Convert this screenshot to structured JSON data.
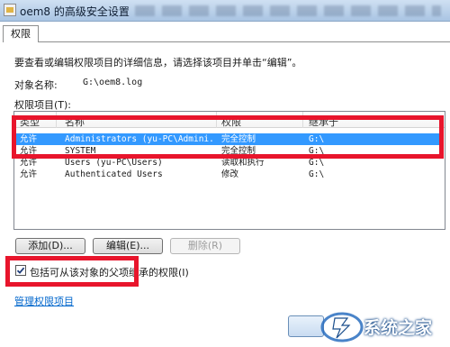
{
  "window": {
    "title": "oem8 的高级安全设置"
  },
  "tabs": [
    {
      "label": "权限"
    }
  ],
  "intro": "要查看或编辑权限项目的详细信息，请选择该项目并单击“编辑”。",
  "object": {
    "label": "对象名称:",
    "value": "G:\\oem8.log"
  },
  "entries_label": "权限项目(T):",
  "columns": [
    "类型",
    "名称",
    "权限",
    "继承于"
  ],
  "rows": [
    {
      "type": "允许",
      "name": "Administrators (yu-PC\\Admini...",
      "permission": "完全控制",
      "inherited": "G:\\",
      "selected": true
    },
    {
      "type": "允许",
      "name": "SYSTEM",
      "permission": "完全控制",
      "inherited": "G:\\",
      "selected": false
    },
    {
      "type": "允许",
      "name": "Users (yu-PC\\Users)",
      "permission": "读取和执行",
      "inherited": "G:\\",
      "selected": false
    },
    {
      "type": "允许",
      "name": "Authenticated Users",
      "permission": "修改",
      "inherited": "G:\\",
      "selected": false
    }
  ],
  "buttons": {
    "add": "添加(D)...",
    "edit": "编辑(E)...",
    "remove": "删除(R)"
  },
  "checkbox": {
    "label": "包括可从该对象的父项继承的权限(I)",
    "checked": true
  },
  "link": "管理权限项目",
  "watermark": {
    "text": "系统之家"
  },
  "colors": {
    "highlight": "#e8152c",
    "selection": "#3399ff",
    "link": "#0066cc"
  },
  "icons": [
    "app-file-icon",
    "checkmark-icon",
    "watermark-logo-icon"
  ]
}
